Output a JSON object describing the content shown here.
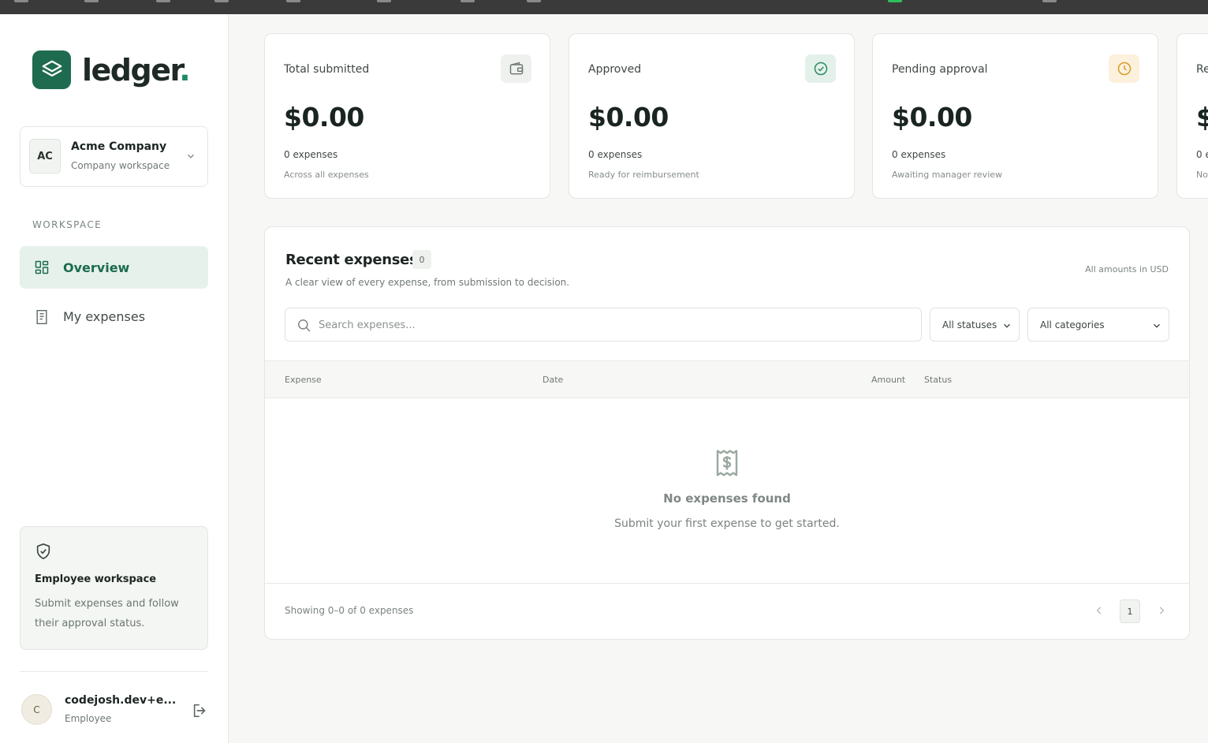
{
  "app": {
    "logo_text": "ledger",
    "logo_dot": ".",
    "brand_color": "#1f6b4f"
  },
  "company": {
    "initials": "AC",
    "name": "Acme Company",
    "subtitle": "Company workspace"
  },
  "sidebar": {
    "section_label": "WORKSPACE",
    "items": [
      {
        "label": "Overview",
        "icon": "grid-icon",
        "active": true
      },
      {
        "label": "My expenses",
        "icon": "document-icon",
        "active": false
      }
    ],
    "promo": {
      "icon": "shield-check-icon",
      "title": "Employee workspace",
      "description": "Submit expenses and follow their approval status."
    },
    "user": {
      "initial": "C",
      "name": "codejosh.dev+e...",
      "role": "Employee"
    }
  },
  "stats": [
    {
      "label": "Total submitted",
      "value": "$0.00",
      "count": "0 expenses",
      "note": "Across all expenses",
      "icon": "wallet-icon",
      "icon_bg": "#eef1ee",
      "icon_color": "#6b7570"
    },
    {
      "label": "Approved",
      "value": "$0.00",
      "count": "0 expenses",
      "note": "Ready for reimbursement",
      "icon": "check-circle-icon",
      "icon_bg": "#e4f1ea",
      "icon_color": "#2b8a60"
    },
    {
      "label": "Pending approval",
      "value": "$0.00",
      "count": "0 expenses",
      "note": "Awaiting manager review",
      "icon": "clock-icon",
      "icon_bg": "#fcf1dc",
      "icon_color": "#d99a2b"
    },
    {
      "label": "Re",
      "value": "$",
      "count": "0 e",
      "note": "No",
      "icon": "",
      "icon_bg": "#ffffff",
      "icon_color": "#ffffff"
    }
  ],
  "recent": {
    "title": "Recent expenses",
    "count": "0",
    "description": "A clear view of every expense, from submission to decision.",
    "currency_note": "All amounts in USD",
    "search_placeholder": "Search expenses...",
    "status_filter": "All statuses",
    "category_filter": "All categories",
    "columns": [
      "Expense",
      "Date",
      "Amount",
      "Status"
    ],
    "empty_title": "No expenses found",
    "empty_description": "Submit your first expense to get started.",
    "showing": "Showing 0–0 of 0 expenses",
    "page": "1"
  }
}
